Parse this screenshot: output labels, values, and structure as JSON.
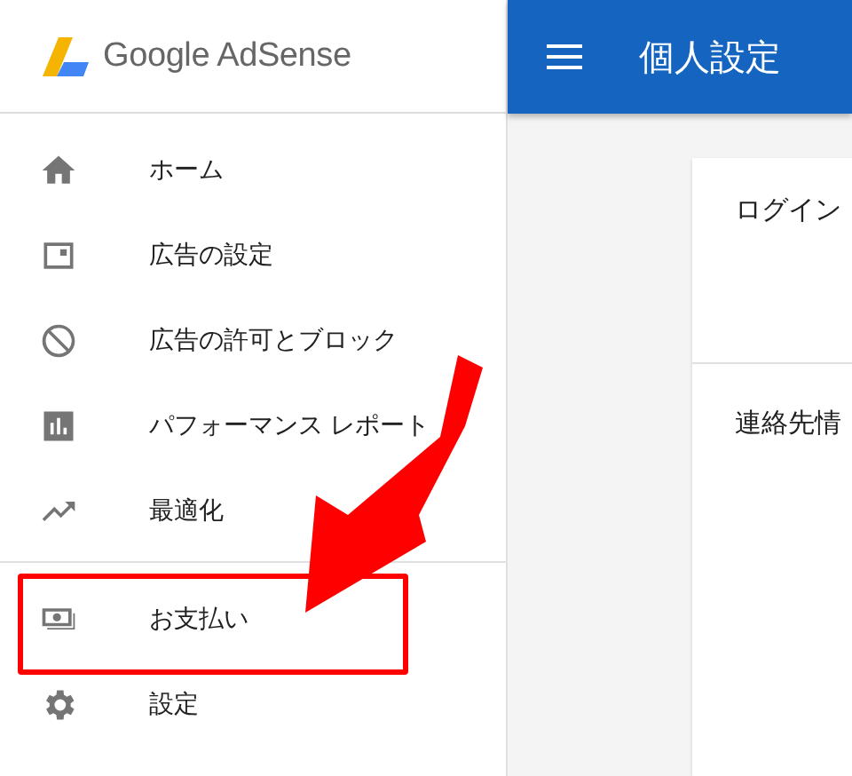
{
  "sidebar": {
    "logo": {
      "text": "Google AdSense"
    },
    "groups": [
      [
        {
          "label": "ホーム"
        },
        {
          "label": "広告の設定"
        },
        {
          "label": "広告の許可とブロック"
        },
        {
          "label": "パフォーマンス レポート"
        },
        {
          "label": "最適化"
        }
      ],
      [
        {
          "label": "お支払い"
        },
        {
          "label": "設定"
        }
      ]
    ]
  },
  "header": {
    "title": "個人設定"
  },
  "card": {
    "sections": [
      {
        "title": "ログイン"
      },
      {
        "title": "連絡先情"
      }
    ]
  }
}
